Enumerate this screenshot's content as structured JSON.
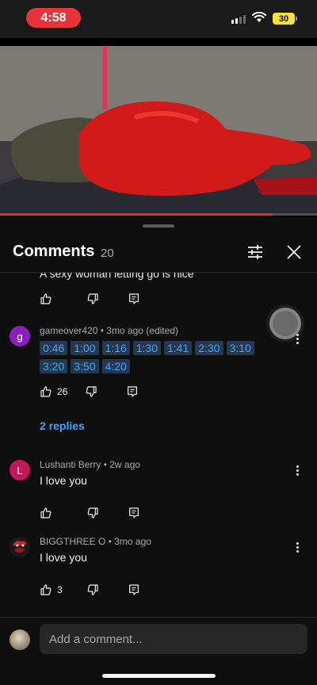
{
  "status_bar": {
    "time": "4:58",
    "battery": "30",
    "icons": [
      "signal-icon",
      "wifi-icon",
      "battery-icon"
    ]
  },
  "video": {
    "progress_fraction": 0.86,
    "progress_color": "#ff1f1f"
  },
  "comments_panel": {
    "title": "Comments",
    "count": "20",
    "partial_comment_text": "A sexy woman letting go is nice",
    "comments": [
      {
        "avatar_letter": "g",
        "avatar_color": "#8a1fbf",
        "author": "gameover420",
        "age": "3mo ago (edited)",
        "timestamps": [
          "0:46",
          "1:00",
          "1:16",
          "1:30",
          "1:41",
          "2:30",
          "3:10",
          "3:20",
          "3:50",
          "4:20"
        ],
        "likes": "26",
        "replies": "2 replies"
      },
      {
        "avatar_letter": "L",
        "avatar_color": "#c2185b",
        "author": "Lushanti Berry",
        "age": "2w ago",
        "text": "I love you"
      },
      {
        "avatar_letter": "",
        "author": "BIGGTHREE O",
        "age": "3mo ago",
        "text": "I love you",
        "likes": "3"
      }
    ]
  },
  "add_comment": {
    "placeholder": "Add a comment..."
  },
  "colors": {
    "accent_link": "#3ea6ff",
    "time_pill": "#e8333b",
    "battery": "#f5e23a",
    "background": "#0f0f0f"
  }
}
